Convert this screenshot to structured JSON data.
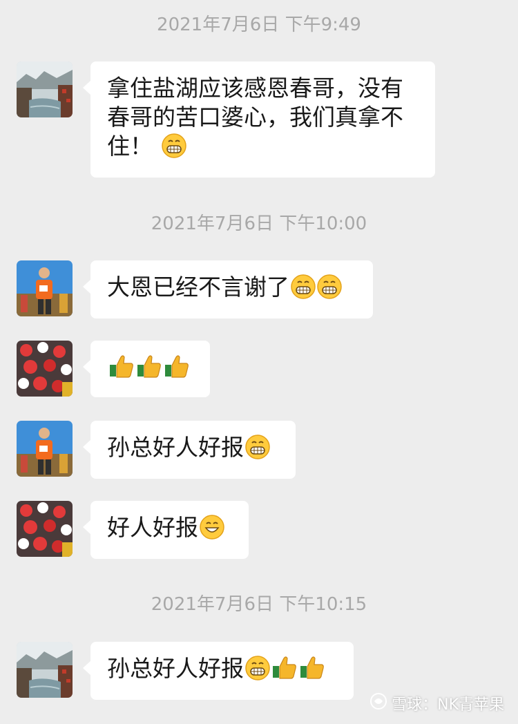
{
  "messages": [
    {
      "timestamp": "2021年7月6日 下午9:49",
      "avatar": "landscape-avatar",
      "text": "拿住盐湖应该感恩春哥，没有春哥的苦口婆心，我们真拿不住！",
      "emojis": [
        "grin-emoji"
      ]
    },
    {
      "timestamp": "2021年7月6日 下午10:00",
      "avatar": "runner-avatar",
      "text": "大恩已经不言谢了",
      "emojis": [
        "grin-emoji",
        "grin-emoji"
      ]
    },
    {
      "avatar": "flowers-avatar",
      "text": "",
      "emojis": [
        "thumbs-up-emoji",
        "thumbs-up-emoji",
        "thumbs-up-emoji"
      ]
    },
    {
      "avatar": "runner-avatar",
      "text": "孙总好人好报",
      "emojis": [
        "grin-emoji"
      ]
    },
    {
      "avatar": "flowers-avatar",
      "text": "好人好报",
      "emojis": [
        "smile-emoji"
      ]
    },
    {
      "timestamp": "2021年7月6日 下午10:15",
      "avatar": "landscape-avatar",
      "text": "孙总好人好报",
      "emojis": [
        "grin-emoji",
        "thumbs-up-emoji",
        "thumbs-up-emoji"
      ]
    }
  ],
  "watermark": {
    "text": "雪球：NK青苹果",
    "icon": "snowball-logo-icon"
  },
  "colors": {
    "background": "#ededed",
    "bubble": "#ffffff",
    "timestamp": "#a8a8a8",
    "text": "#191919"
  }
}
